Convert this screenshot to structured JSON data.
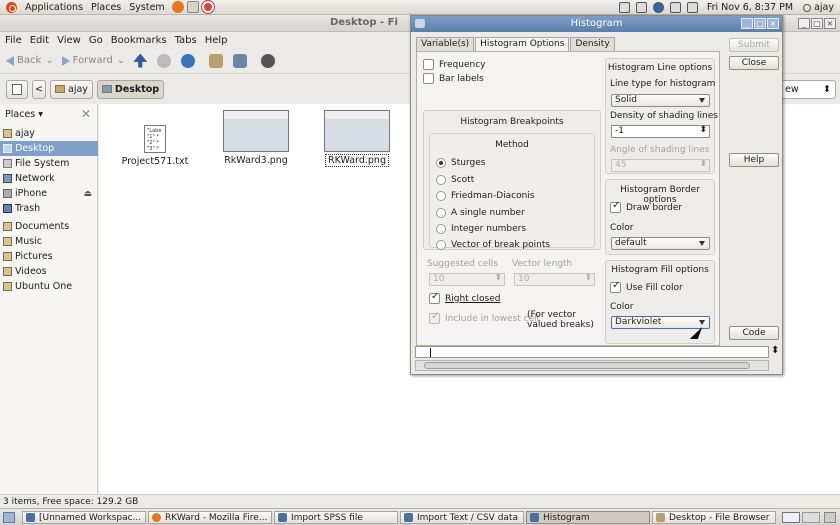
{
  "top_panel": {
    "menus": [
      "Applications",
      "Places",
      "System"
    ],
    "clock": "Fri Nov  6,  8:37 PM",
    "user": "ajay"
  },
  "file_browser": {
    "title": "Desktop - Fi",
    "menu": [
      "File",
      "Edit",
      "View",
      "Go",
      "Bookmarks",
      "Tabs",
      "Help"
    ],
    "toolbar": {
      "back": "Back",
      "forward": "Forward"
    },
    "path": [
      "ajay",
      "Desktop"
    ],
    "view_mode": "ew",
    "sidebar": {
      "header": "Places",
      "items": [
        "ajay",
        "Desktop",
        "File System",
        "Network",
        "iPhone",
        "Trash"
      ],
      "bookmarks": [
        "Documents",
        "Music",
        "Pictures",
        "Videos",
        "Ubuntu One"
      ]
    },
    "files": [
      "Project571.txt",
      "RkWard3.png",
      "RKWard.png"
    ],
    "txt_preview": "\"Labe\n\"1\" *\n\"2\" *\n\"3\" *",
    "status": "3 items, Free space: 129.2 GB"
  },
  "dialog": {
    "title": "Histogram",
    "tabs": [
      "Variable(s)",
      "Histogram Options",
      "Density"
    ],
    "active_tab": "Histogram Options",
    "frequency": "Frequency",
    "bar_labels": "Bar labels",
    "breakpoints": {
      "title": "Histogram Breakpoints",
      "method_label": "Method",
      "methods": [
        "Sturges",
        "Scott",
        "Friedman-Diaconis",
        "A single number",
        "Integer numbers",
        "Vector of break points"
      ],
      "selected": "Sturges",
      "suggested_cells_label": "Suggested cells",
      "suggested_cells_value": "10",
      "vector_length_label": "Vector length",
      "vector_length_value": "10",
      "right_closed": "Right closed",
      "include_lowest": "Include in lowest cell",
      "vector_note": "(For vector valued breaks)"
    },
    "line_options": {
      "title": "Histogram Line options",
      "line_type_label": "Line type for histogram",
      "line_type": "Solid",
      "density_label": "Density of shading lines",
      "density_value": "-1",
      "angle_label": "Angle of shading lines",
      "angle_value": "45"
    },
    "border_options": {
      "title": "Histogram Border options",
      "draw_border": "Draw border",
      "color_label": "Color",
      "color": "default"
    },
    "fill_options": {
      "title": "Histogram Fill options",
      "use_fill": "Use Fill color",
      "color_label": "Color",
      "color": "Darkviolet"
    },
    "buttons": {
      "submit": "Submit",
      "close": "Close",
      "help": "Help",
      "code": "Code"
    }
  },
  "taskbar": [
    "[Unnamed Workspac...",
    "RKWard - Mozilla Fire...",
    "Import SPSS file",
    "Import Text / CSV data",
    "Histogram",
    "Desktop - File Browser"
  ],
  "colors": {
    "selection": "#7fa0c8",
    "titlebar": "#6a8cb8",
    "ubuntu": "#dd4814"
  }
}
